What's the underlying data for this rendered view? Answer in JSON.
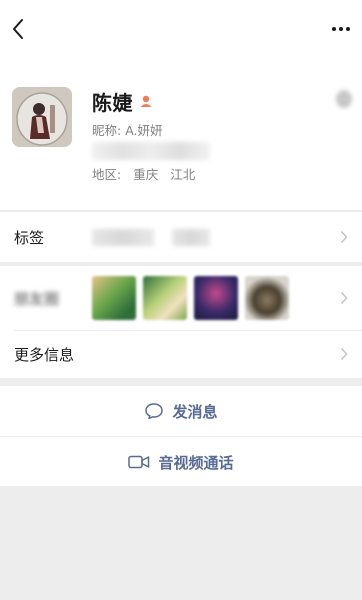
{
  "profile": {
    "name": "陈婕",
    "nickname_label": "昵称:",
    "nickname": "A.妍妍",
    "region_label": "地区:",
    "region_city": "重庆",
    "region_district": "江北",
    "gender_color": "#f27a5a"
  },
  "rows": {
    "tags_label": "标签",
    "more_info_label": "更多信息"
  },
  "actions": {
    "send_message": "发消息",
    "video_call": "音视频通话"
  },
  "icons": [
    "back-arrow-icon",
    "more-dots-icon",
    "chevron-right-icon",
    "chat-bubble-icon",
    "video-camera-icon"
  ],
  "colors": {
    "accent": "#576b95",
    "background": "#ededed",
    "card": "#ffffff",
    "secondary_text": "#808080"
  }
}
